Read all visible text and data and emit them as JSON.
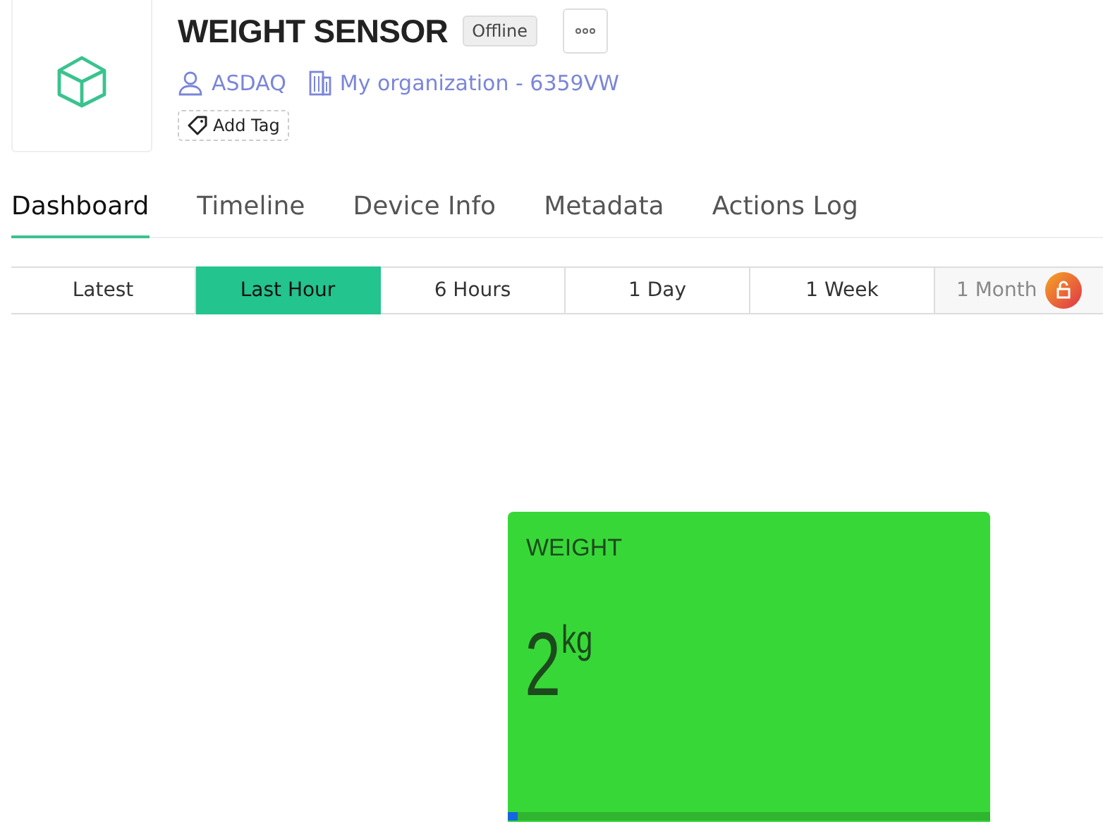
{
  "device": {
    "name": "WEIGHT SENSOR",
    "status": "Offline",
    "owner": "ASDAQ",
    "organization": "My organization - 6359VW",
    "add_tag": "Add Tag"
  },
  "tabs": [
    {
      "label": "Dashboard",
      "selected": true
    },
    {
      "label": "Timeline",
      "selected": false
    },
    {
      "label": "Device Info",
      "selected": false
    },
    {
      "label": "Metadata",
      "selected": false
    },
    {
      "label": "Actions Log",
      "selected": false
    }
  ],
  "time_ranges": [
    {
      "label": "Latest",
      "selected": false,
      "locked": false
    },
    {
      "label": "Last Hour",
      "selected": true,
      "locked": false
    },
    {
      "label": "6 Hours",
      "selected": false,
      "locked": false
    },
    {
      "label": "1 Day",
      "selected": false,
      "locked": false
    },
    {
      "label": "1 Week",
      "selected": false,
      "locked": false
    },
    {
      "label": "1 Month",
      "selected": false,
      "locked": true
    }
  ],
  "widget": {
    "title": "WEIGHT",
    "value": "2",
    "unit": "kg",
    "level": 0.02
  }
}
